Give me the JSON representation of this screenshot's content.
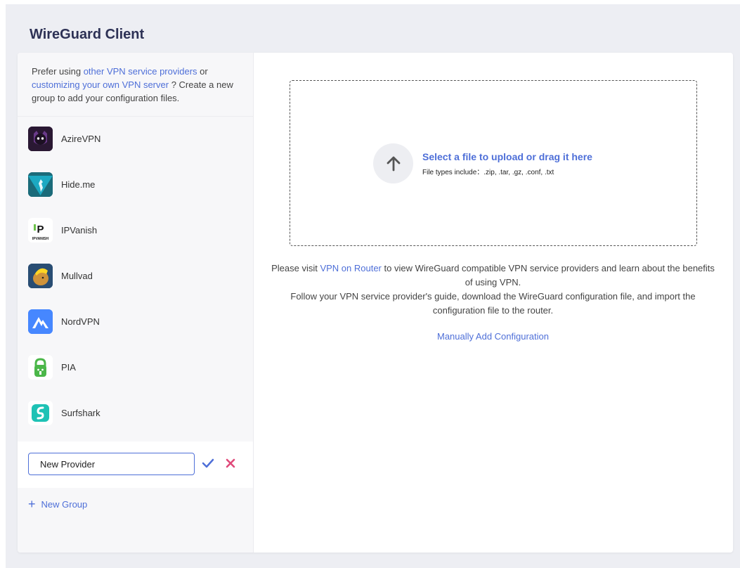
{
  "header": {
    "title": "WireGuard Client"
  },
  "sidebar": {
    "intro": {
      "prefix": "Prefer using ",
      "link1": "other VPN service providers",
      "middle": " or ",
      "link2": "customizing your own VPN server",
      "suffix": " ? Create a new group to add your configuration files."
    },
    "providers": [
      {
        "name": "AzireVPN",
        "icon": "azirevpn-logo-icon"
      },
      {
        "name": "Hide.me",
        "icon": "hideme-logo-icon"
      },
      {
        "name": "IPVanish",
        "icon": "ipvanish-logo-icon"
      },
      {
        "name": "Mullvad",
        "icon": "mullvad-logo-icon"
      },
      {
        "name": "NordVPN",
        "icon": "nordvpn-logo-icon"
      },
      {
        "name": "PIA",
        "icon": "pia-logo-icon"
      },
      {
        "name": "Surfshark",
        "icon": "surfshark-logo-icon"
      }
    ],
    "new_provider": {
      "value": "New Provider"
    },
    "new_group_label": "New Group"
  },
  "main": {
    "upload": {
      "title": "Select a file to upload or drag it here",
      "types": "File types include：.zip, .tar, .gz, .conf, .txt"
    },
    "info": {
      "prefix": "Please visit ",
      "link": "VPN on Router",
      "line1_suffix": " to view WireGuard compatible VPN service providers and learn about the benefits of using VPN.",
      "line2": "Follow your VPN service provider's guide, download the WireGuard configuration file, and import the configuration file to the router."
    },
    "manual_add": "Manually Add Configuration"
  },
  "colors": {
    "accent": "#4e6fd8",
    "title": "#2d3155",
    "cancel": "#e0497a",
    "page_bg": "#edeef3"
  }
}
